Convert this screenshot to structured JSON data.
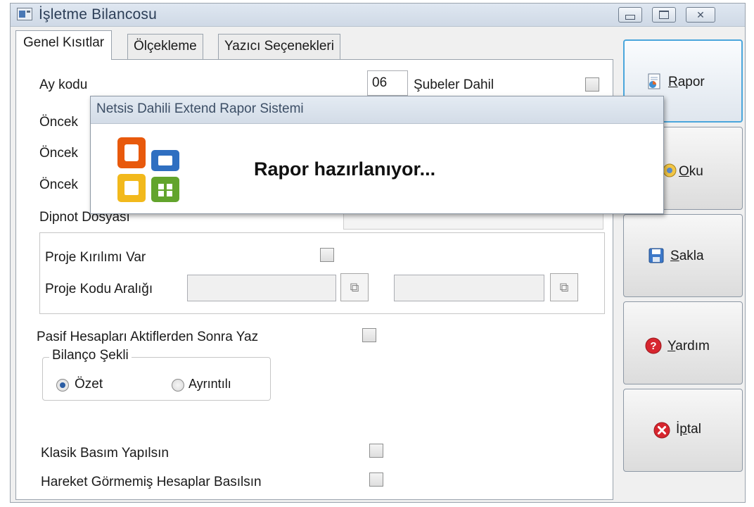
{
  "window": {
    "title": "İşletme Bilancosu",
    "close_glyph": "✕"
  },
  "tabs": [
    {
      "label": "Genel Kısıtlar",
      "active": true
    },
    {
      "label": "Ölçekleme",
      "active": false
    },
    {
      "label": "Yazıcı Seçenekleri",
      "active": false
    }
  ],
  "form": {
    "ay_kodu_label": "Ay kodu",
    "ay_kodu_value": "06",
    "subeler_dahil_label": "Şubeler Dahil",
    "oncek_1": "Öncek",
    "oncek_2": "Öncek",
    "oncek_3": "Öncek",
    "dipnot_label": "Dipnot Dosyası",
    "proje_kirilimi_label": "Proje Kırılımı Var",
    "proje_kodu_araligi_label": "Proje Kodu Aralığı",
    "pasif_label": "Pasif Hesapları  Aktiflerden Sonra Yaz",
    "bilanco_sekli_label": "Bilanço Şekli",
    "ozet_label": "Özet",
    "ayrintili_label": "Ayrıntılı",
    "klasik_label": "Klasik Basım Yapılsın",
    "hareket_label": "Hareket Görmemiş Hesaplar Basılsın"
  },
  "buttons": {
    "rapor": {
      "mnemonic": "R",
      "rest": "apor"
    },
    "oku": {
      "mnemonic": "O",
      "rest": "ku"
    },
    "sakla": {
      "mnemonic": "S",
      "rest": "akla"
    },
    "yardim": {
      "mnemonic": "Y",
      "rest": "ardım"
    },
    "iptal": {
      "prefix": "İ",
      "mnemonic": "p",
      "rest": "tal"
    }
  },
  "popup": {
    "title": "Netsis Dahili Extend  Rapor Sistemi",
    "message": "Rapor hazırlanıyor..."
  },
  "colors": {
    "accent": "#4aa6dc",
    "office_orange": "#e8590c",
    "office_green": "#62a42c",
    "office_blue": "#2f6fc1",
    "office_yellow": "#f2b91c"
  }
}
